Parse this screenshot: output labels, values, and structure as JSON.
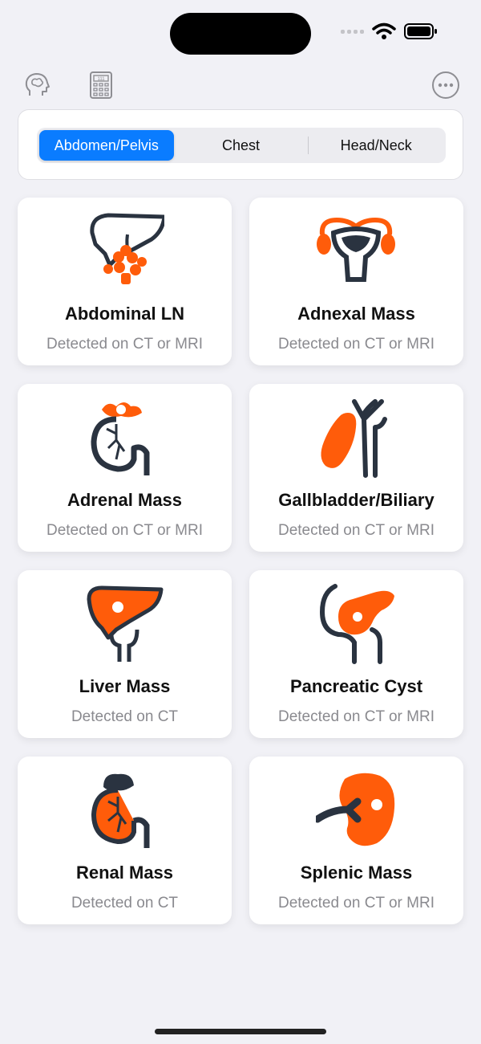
{
  "status_bar": {
    "wifi_icon": "wifi-icon",
    "battery_icon": "battery-icon"
  },
  "toolbar": {
    "left_icons": [
      "brain-icon",
      "calculator-icon"
    ],
    "right_icon": "more-icon",
    "calculator_display": "111"
  },
  "segments": [
    {
      "label": "Abdomen/Pelvis",
      "active": true
    },
    {
      "label": "Chest",
      "active": false
    },
    {
      "label": "Head/Neck",
      "active": false
    }
  ],
  "cards": [
    {
      "title": "Abdominal LN",
      "subtitle": "Detected on CT or MRI",
      "icon": "liver-lymph-node-icon"
    },
    {
      "title": "Adnexal Mass",
      "subtitle": "Detected on CT or MRI",
      "icon": "uterus-ovaries-icon"
    },
    {
      "title": "Adrenal Mass",
      "subtitle": "Detected on CT or MRI",
      "icon": "kidney-adrenal-icon"
    },
    {
      "title": "Gallbladder/Biliary",
      "subtitle": "Detected on CT or MRI",
      "icon": "gallbladder-icon"
    },
    {
      "title": "Liver Mass",
      "subtitle": "Detected on CT",
      "icon": "liver-icon"
    },
    {
      "title": "Pancreatic Cyst",
      "subtitle": "Detected on CT or MRI",
      "icon": "pancreas-icon"
    },
    {
      "title": "Renal Mass",
      "subtitle": "Detected on CT",
      "icon": "kidney-icon"
    },
    {
      "title": "Splenic Mass",
      "subtitle": "Detected on CT or MRI",
      "icon": "spleen-icon"
    }
  ],
  "colors": {
    "accent": "#0a7cff",
    "organ_orange": "#ff5c0a",
    "organ_dark": "#2a3340"
  }
}
